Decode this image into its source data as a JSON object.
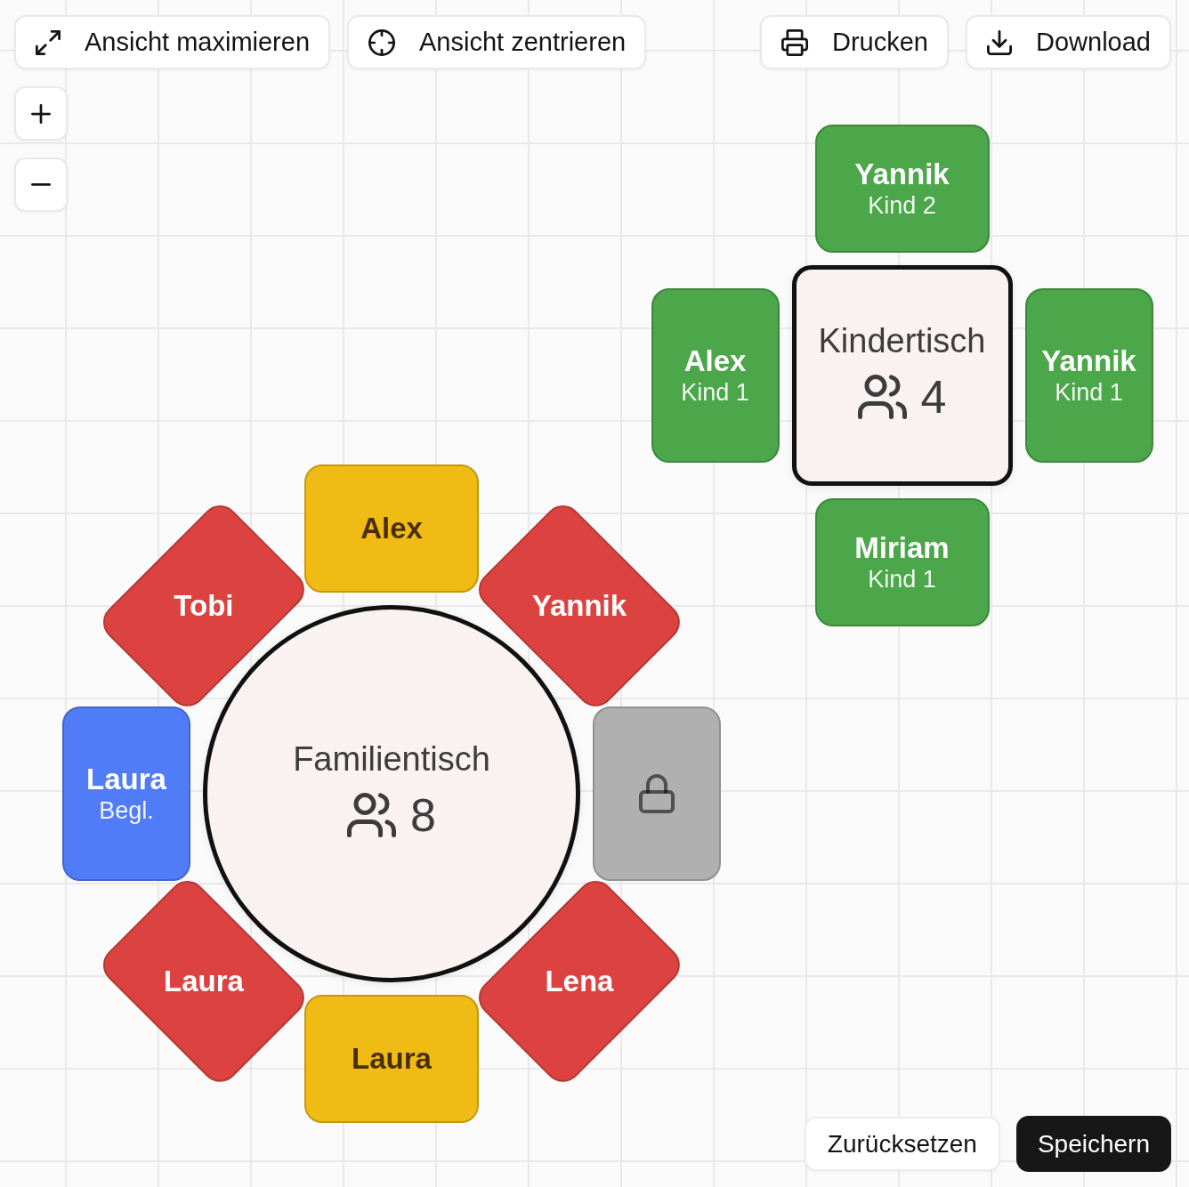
{
  "toolbar": {
    "left": [
      {
        "kind": "maximize",
        "label": "Ansicht maximieren"
      },
      {
        "kind": "center",
        "label": "Ansicht zentrieren"
      }
    ],
    "right": [
      {
        "kind": "print",
        "label": "Drucken"
      },
      {
        "kind": "download",
        "label": "Download"
      }
    ]
  },
  "zoom_controls": [
    {
      "kind": "zoom_in"
    },
    {
      "kind": "zoom_out"
    }
  ],
  "tables": [
    {
      "name": "Kindertisch",
      "kind": "square",
      "guest_count": "4",
      "seats": [
        {
          "name": "Yannik",
          "role": "Kind 2",
          "color": "#4ca64a",
          "locked": false
        },
        {
          "name": "Yannik",
          "role": "Kind 1",
          "color": "#4ca64a",
          "locked": false
        },
        {
          "name": "Miriam",
          "role": "Kind 1",
          "color": "#4ca64a",
          "locked": false
        },
        {
          "name": "Alex",
          "role": "Kind 1",
          "color": "#4ca64a",
          "locked": false
        }
      ]
    },
    {
      "name": "Familientisch",
      "kind": "round",
      "guest_count": "8",
      "seats": [
        {
          "name": "Alex",
          "color": "#efbb14",
          "locked": false
        },
        {
          "name": "Yannik",
          "color": "#dc4340",
          "locked": false
        },
        {
          "color": "#b0b0b0",
          "locked": true
        },
        {
          "name": "Lena",
          "color": "#dc4340",
          "locked": false
        },
        {
          "name": "Laura",
          "color": "#efbb14",
          "locked": false
        },
        {
          "name": "Laura",
          "color": "#dc4340",
          "locked": false
        },
        {
          "name": "Laura",
          "role": "Begl.",
          "color": "#517cf7",
          "locked": false
        },
        {
          "name": "Tobi",
          "color": "#dc4340",
          "locked": false
        }
      ]
    }
  ],
  "actions": [
    {
      "kind": "reset",
      "label": "Zurücksetzen"
    },
    {
      "kind": "save",
      "label": "Speichern"
    }
  ]
}
